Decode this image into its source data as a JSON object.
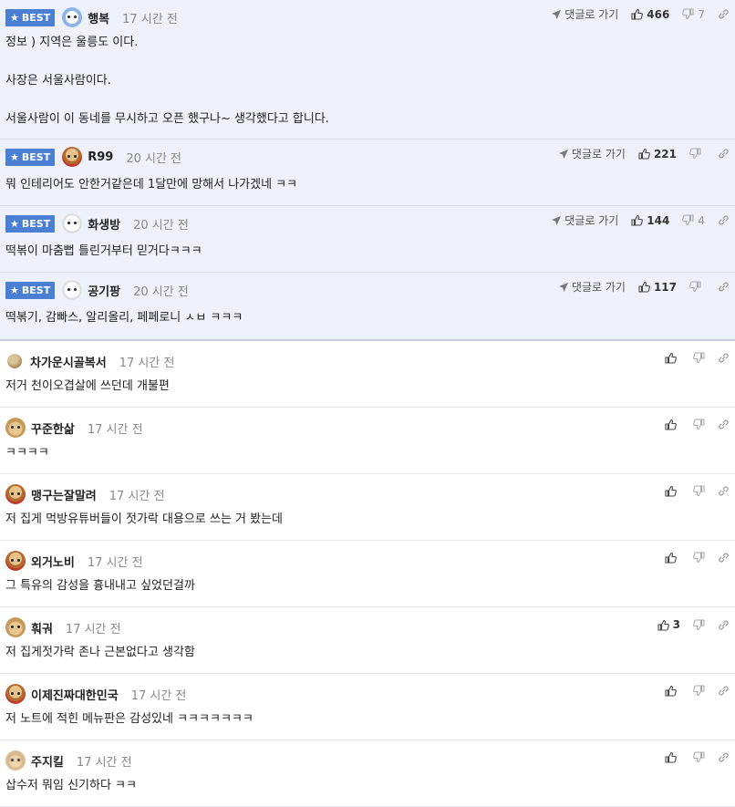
{
  "ui": {
    "best_label": "BEST",
    "reply_link_label": "댓글로 가기"
  },
  "best_comments": [
    {
      "nick": "행복",
      "time": "17 시간 전",
      "avatar": "blue-dog-avatar",
      "likes": "466",
      "dislikes": "7",
      "lines": [
        "정보 ) 지역은 울릉도 이다.",
        "",
        "사장은 서울사람이다.",
        "",
        "서울사람이 이 동네를 무시하고 오픈 했구나~ 생각했다고 합니다."
      ]
    },
    {
      "nick": "R99",
      "time": "20 시간 전",
      "avatar": "dog-red-avatar",
      "likes": "221",
      "dislikes": "",
      "lines": [
        "뭐 인테리어도 안한거같은데 1달만에 망해서 나가겠네 ㅋㅋ"
      ]
    },
    {
      "nick": "화생방",
      "time": "20 시간 전",
      "avatar": "white-dog-avatar",
      "likes": "144",
      "dislikes": "4",
      "lines": [
        "떡볶이 마춤뻡 틀린거부터 믿거다ㅋㅋㅋ"
      ]
    },
    {
      "nick": "공기팡",
      "time": "20 시간 전",
      "avatar": "white-dog-avatar",
      "likes": "117",
      "dislikes": "",
      "lines": [
        "떡볶기, 감빠스, 알리올리, 페페로니 ㅅㅂ ㅋㅋㅋ"
      ]
    }
  ],
  "comments": [
    {
      "nick": "차가운시골복서",
      "time": "17 시간 전",
      "avatar": "ball-avatar",
      "likes": "",
      "text": "저거 천이오겹살에 쓰던데 개불편"
    },
    {
      "nick": "꾸준한삶",
      "time": "17 시간 전",
      "avatar": "dog-avatar",
      "likes": "",
      "text": "ㅋㅋㅋㅋ"
    },
    {
      "nick": "맹구는잘말려",
      "time": "17 시간 전",
      "avatar": "dog-red-avatar",
      "likes": "",
      "text": "저 집게 먹방유튜버들이 젓가락 대용으로 쓰는 거 봤는데"
    },
    {
      "nick": "외거노비",
      "time": "17 시간 전",
      "avatar": "dog-red-avatar",
      "likes": "",
      "text": "그 특유의 감성을 흉내내고 싶었던걸까"
    },
    {
      "nick": "훠궈",
      "time": "17 시간 전",
      "avatar": "dog-avatar",
      "likes": "3",
      "text": "저 집게젓가락 존나 근본없다고 생각함"
    },
    {
      "nick": "이제진짜대한민국",
      "time": "17 시간 전",
      "avatar": "dog-red-avatar",
      "likes": "",
      "text": "저 노트에 적힌 메뉴판은 감성있네 ㅋㅋㅋㅋㅋㅋㅋ"
    },
    {
      "nick": "주지킬",
      "time": "17 시간 전",
      "avatar": "fuzzy-dog-avatar",
      "likes": "",
      "text": "삽수저 뭐임 신기하다 ㅋㅋ"
    }
  ]
}
